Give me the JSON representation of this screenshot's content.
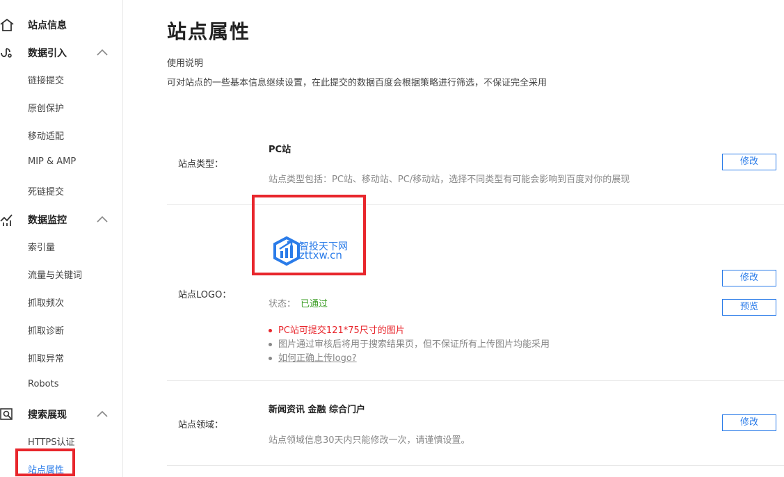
{
  "sidebar": {
    "site_info": {
      "label": "站点信息"
    },
    "data_import": {
      "label": "数据引入",
      "items": [
        "链接提交",
        "原创保护",
        "移动适配",
        "MIP & AMP",
        "死链提交"
      ]
    },
    "data_monitor": {
      "label": "数据监控",
      "items": [
        "索引量",
        "流量与关键词",
        "抓取频次",
        "抓取诊断",
        "抓取异常",
        "Robots"
      ]
    },
    "search_display": {
      "label": "搜索展现",
      "items": [
        "HTTPS认证",
        "站点属性"
      ]
    }
  },
  "main": {
    "title": "站点属性",
    "usage_title": "使用说明",
    "usage_desc": "可对站点的一些基本信息继续设置，在此提交的数据百度会根据策略进行筛选，不保证完全采用",
    "site_type": {
      "label": "站点类型：",
      "value": "PC站",
      "note": "站点类型包括：PC站、移动站、PC/移动站，选择不同类型有可能会影响到百度对你的展现",
      "edit_label": "修改"
    },
    "site_logo": {
      "label": "站点LOGO：",
      "logo_text_cn": "智投天下网",
      "logo_text_en": "zttxw.cn",
      "status_label": "状态：",
      "status_value": "已通过",
      "bullets": [
        "PC站可提交121*75尺寸的图片",
        "图片通过审核后将用于搜索结果页，但不保证所有上传图片均能采用",
        "如何正确上传logo?"
      ],
      "edit_label": "修改",
      "preview_label": "预览"
    },
    "site_domain": {
      "label": "站点领域：",
      "value": "新闻资讯 金融 综合门户",
      "note": "站点领域信息30天内只能修改一次，请谨慎设置。",
      "edit_label": "修改"
    }
  },
  "colors": {
    "accent": "#2b7ce9",
    "highlight": "#e8262c",
    "success": "#3a9d23"
  }
}
